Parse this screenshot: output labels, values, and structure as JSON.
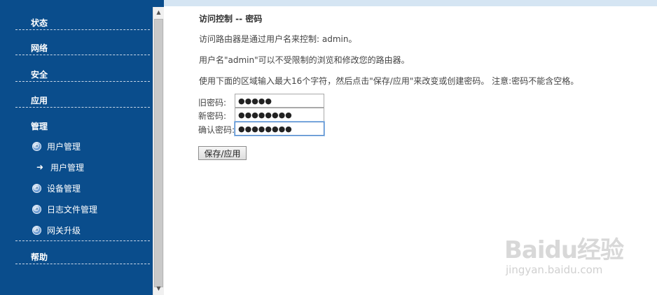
{
  "sidebar": {
    "menus": {
      "status": "状态",
      "network": "网络",
      "security": "安全",
      "application": "应用",
      "management": "管理",
      "help": "帮助"
    },
    "sub_items": {
      "user_management": "用户管理",
      "user_management_current": "用户管理",
      "device_management": "设备管理",
      "log_file_management": "日志文件管理",
      "gateway_upgrade": "网关升级"
    }
  },
  "main": {
    "title": "访问控制 -- 密码",
    "line1": "访问路由器是通过用户名来控制: admin。",
    "line2": "用户名\"admin\"可以不受限制的浏览和修改您的路由器。",
    "line3": "使用下面的区域输入最大16个字符，然后点击\"保存/应用\"来改变或创建密码。 注意:密码不能含空格。",
    "fields": {
      "old_password_label": "旧密码:",
      "old_password_value": "●●●●●",
      "new_password_label": "新密码:",
      "new_password_value": "●●●●●●●●",
      "confirm_password_label": "确认密码:",
      "confirm_password_value": "●●●●●●●●"
    },
    "save_button": "保存/应用"
  },
  "watermark": {
    "logo": "Baidu经验",
    "url": "jingyan.baidu.com"
  }
}
